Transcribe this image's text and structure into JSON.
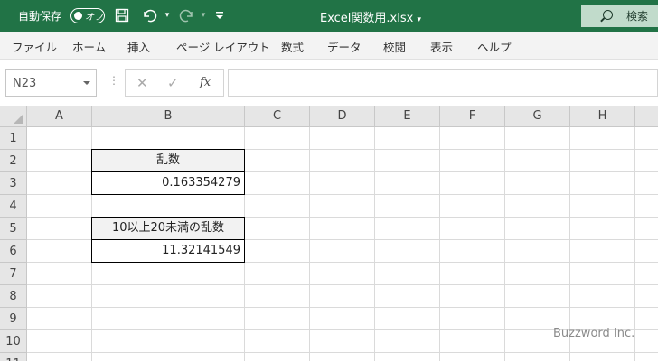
{
  "titlebar": {
    "autosave_label": "自動保存",
    "autosave_state": "オフ",
    "filename": "Excel関数用.xlsx",
    "search_label": "検索",
    "accent_color": "#217346",
    "icons": [
      "save-icon",
      "undo-icon",
      "redo-icon",
      "customize-toolbar-icon",
      "search-icon"
    ]
  },
  "ribbon": {
    "tabs": [
      "ファイル",
      "ホーム",
      "挿入",
      "ページ レイアウト",
      "数式",
      "データ",
      "校閲",
      "表示",
      "ヘルプ"
    ]
  },
  "formula_bar": {
    "name_box": "N23",
    "fx_label": "fx",
    "formula": ""
  },
  "sheet": {
    "columns": [
      "A",
      "B",
      "C",
      "D",
      "E",
      "F",
      "G",
      "H"
    ],
    "rows": [
      "1",
      "2",
      "3",
      "4",
      "5",
      "6",
      "7",
      "8",
      "9",
      "10",
      "11"
    ],
    "cells": {
      "B2": "乱数",
      "B3": "0.163354279",
      "B5": "10以上20未満の乱数",
      "B6": "11.32141549"
    }
  },
  "watermark": "Buzzword Inc."
}
